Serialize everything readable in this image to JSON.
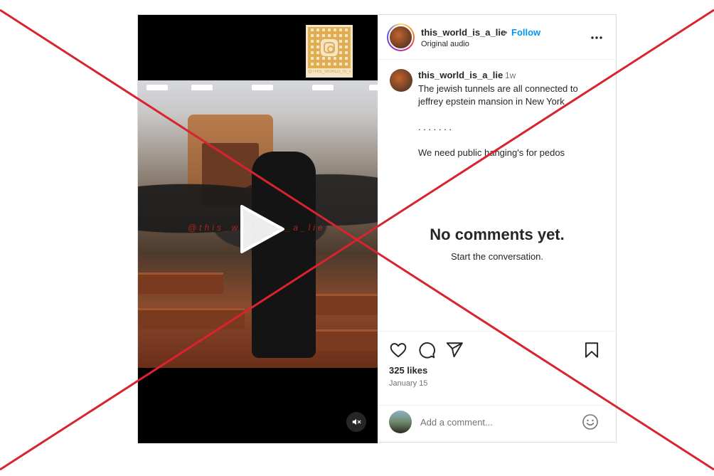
{
  "post": {
    "username": "this_world_is_a_lie",
    "separator": "•",
    "follow_label": "Follow",
    "audio_label": "Original audio",
    "time_ago": "1w",
    "caption_lines": [
      "The jewish tunnels are all connected to",
      "jeffrey epstein mansion in New York",
      ". . . . . . .",
      "We need public hanging's for pedos"
    ],
    "likes": "325 likes",
    "date": "January 15"
  },
  "media": {
    "qr_label": "@THIS_WORLD_IS_A_LIE",
    "watermark": "@this_world_is_a_lie",
    "play_icon": "play-icon",
    "mute_icon": "muted-speaker-icon"
  },
  "comments": {
    "empty_title": "No comments yet.",
    "empty_subtitle": "Start the conversation.",
    "input_placeholder": "Add a comment..."
  },
  "colors": {
    "follow": "#0095f6",
    "overlay_x": "#d9232e",
    "muted_text": "#737373"
  },
  "icons": [
    "heart-icon",
    "comment-icon",
    "share-icon",
    "bookmark-icon",
    "more-icon",
    "emoji-icon"
  ]
}
